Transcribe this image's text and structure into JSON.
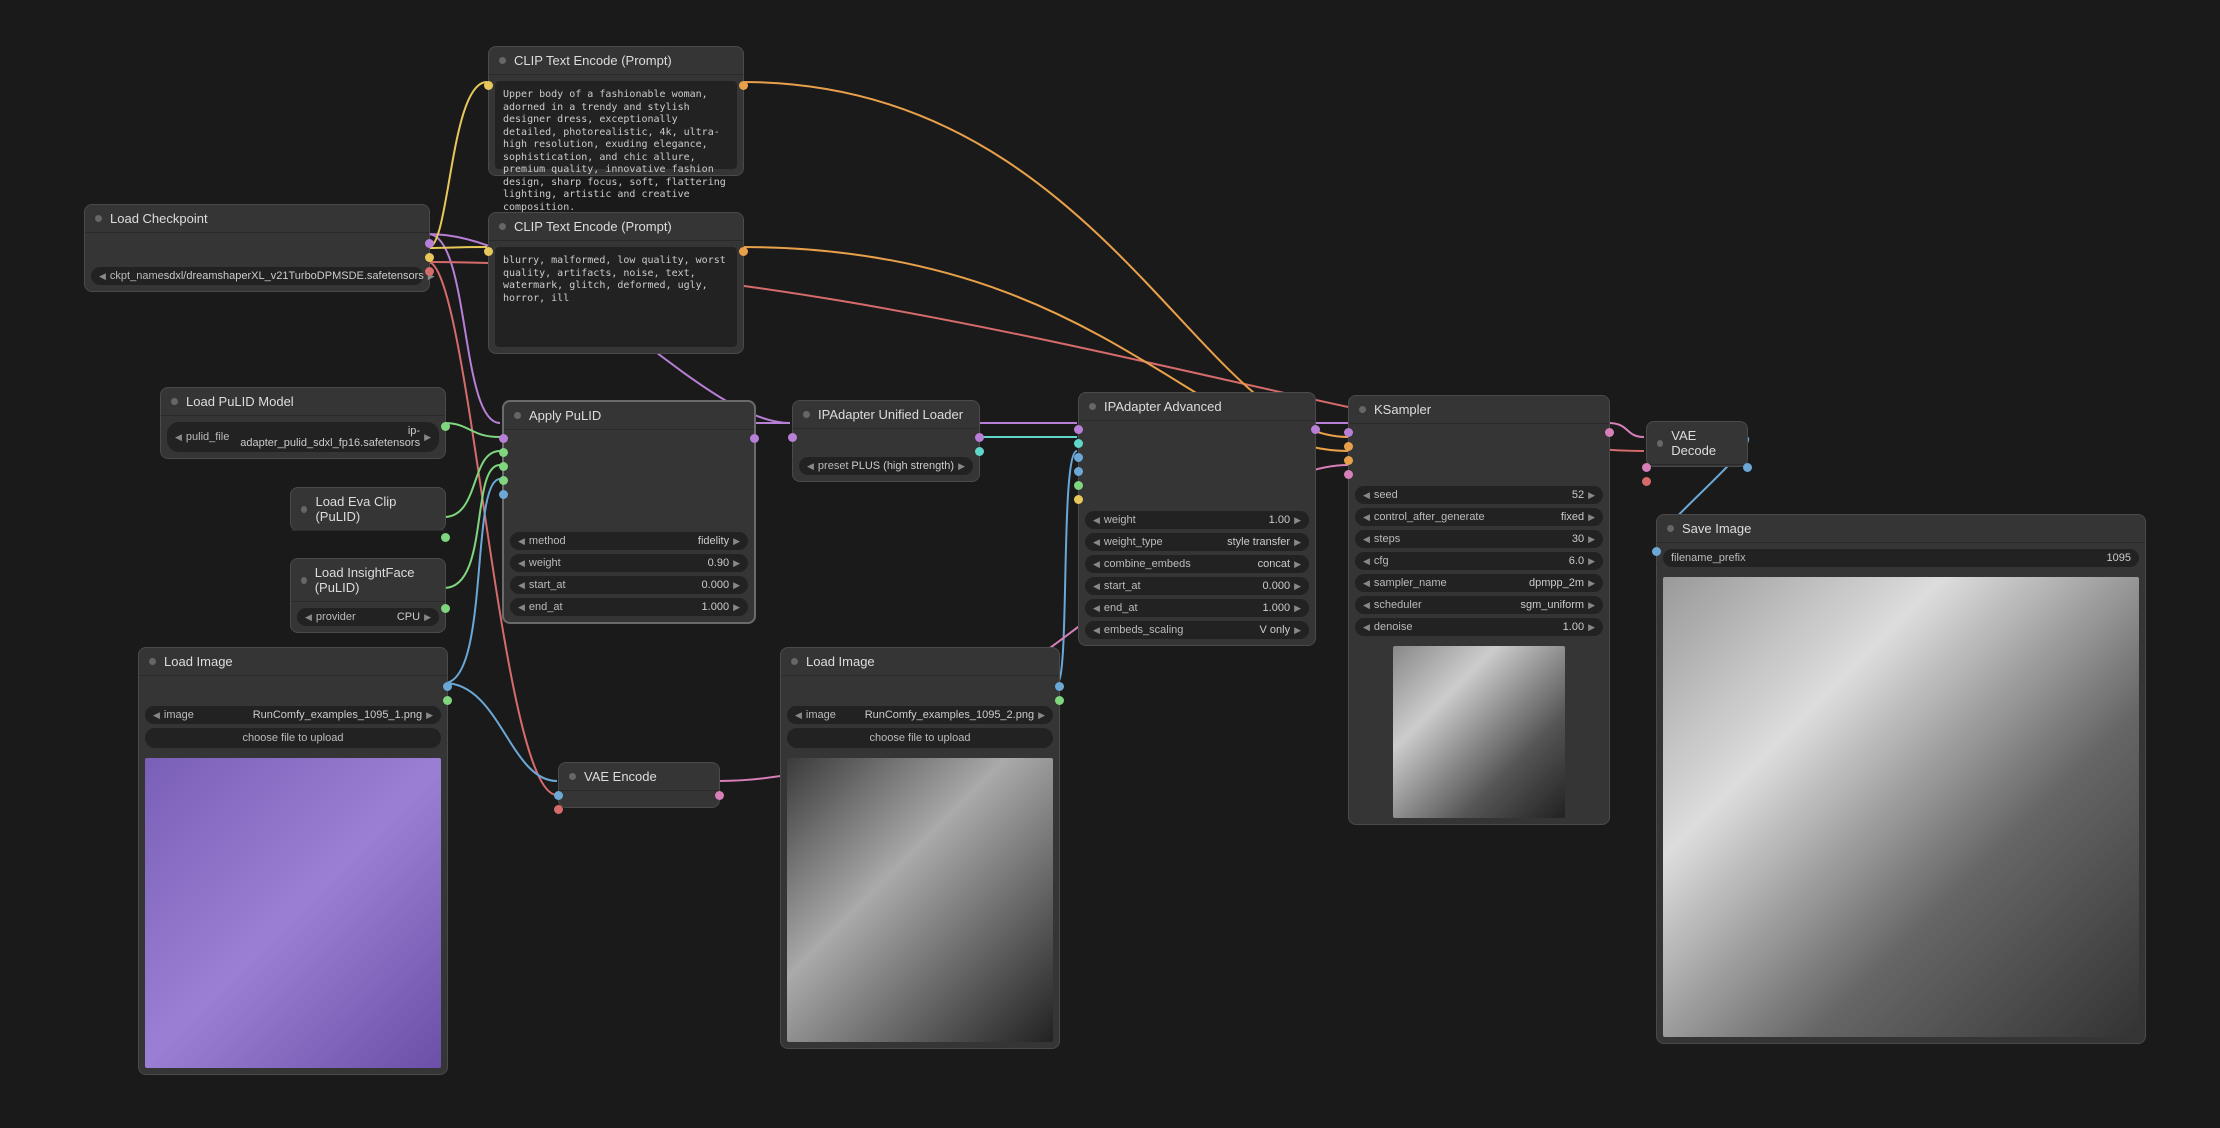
{
  "load_checkpoint": {
    "title": "Load Checkpoint",
    "ckpt_label": "ckpt_name",
    "ckpt_value": "sdxl/dreamshaperXL_v21TurboDPMSDE.safetensors"
  },
  "clip_positive": {
    "title": "CLIP Text Encode (Prompt)",
    "text": "Upper body of a fashionable woman, adorned in a trendy and stylish designer dress, exceptionally detailed, photorealistic, 4k, ultra-high resolution, exuding elegance, sophistication, and chic allure, premium quality, innovative fashion design, sharp focus, soft, flattering lighting, artistic and creative composition."
  },
  "clip_negative": {
    "title": "CLIP Text Encode (Prompt)",
    "text": "blurry, malformed, low quality, worst quality, artifacts, noise, text, watermark, glitch, deformed, ugly, horror, ill"
  },
  "load_pulid_model": {
    "title": "Load PuLID Model",
    "pulid_file_label": "pulid_file",
    "pulid_file_value": "ip-adapter_pulid_sdxl_fp16.safetensors"
  },
  "load_eva_clip": {
    "title": "Load Eva Clip (PuLID)"
  },
  "load_insightface": {
    "title": "Load InsightFace (PuLID)",
    "provider_label": "provider",
    "provider_value": "CPU"
  },
  "apply_pulid": {
    "title": "Apply PuLID",
    "method_label": "method",
    "method_value": "fidelity",
    "weight_label": "weight",
    "weight_value": "0.90",
    "start_at_label": "start_at",
    "start_at_value": "0.000",
    "end_at_label": "end_at",
    "end_at_value": "1.000"
  },
  "load_image_1": {
    "title": "Load Image",
    "image_label": "image",
    "image_value": "RunComfy_examples_1095_1.png",
    "upload": "choose file to upload"
  },
  "vae_encode": {
    "title": "VAE Encode"
  },
  "ipadapter_unified": {
    "title": "IPAdapter Unified Loader",
    "preset_label": "preset",
    "preset_value": "PLUS (high strength)"
  },
  "load_image_2": {
    "title": "Load Image",
    "image_label": "image",
    "image_value": "RunComfy_examples_1095_2.png",
    "upload": "choose file to upload"
  },
  "ipadapter_advanced": {
    "title": "IPAdapter Advanced",
    "weight_label": "weight",
    "weight_value": "1.00",
    "weight_type_label": "weight_type",
    "weight_type_value": "style transfer",
    "combine_label": "combine_embeds",
    "combine_value": "concat",
    "start_at_label": "start_at",
    "start_at_value": "0.000",
    "end_at_label": "end_at",
    "end_at_value": "1.000",
    "embeds_label": "embeds_scaling",
    "embeds_value": "V only"
  },
  "ksampler": {
    "title": "KSampler",
    "seed_label": "seed",
    "seed_value": "52",
    "control_label": "control_after_generate",
    "control_value": "fixed",
    "steps_label": "steps",
    "steps_value": "30",
    "cfg_label": "cfg",
    "cfg_value": "6.0",
    "sampler_label": "sampler_name",
    "sampler_value": "dpmpp_2m",
    "scheduler_label": "scheduler",
    "scheduler_value": "sgm_uniform",
    "denoise_label": "denoise",
    "denoise_value": "1.00"
  },
  "vae_decode": {
    "title": "VAE Decode"
  },
  "save_image": {
    "title": "Save Image",
    "prefix_label": "filename_prefix",
    "prefix_value": "1095"
  }
}
